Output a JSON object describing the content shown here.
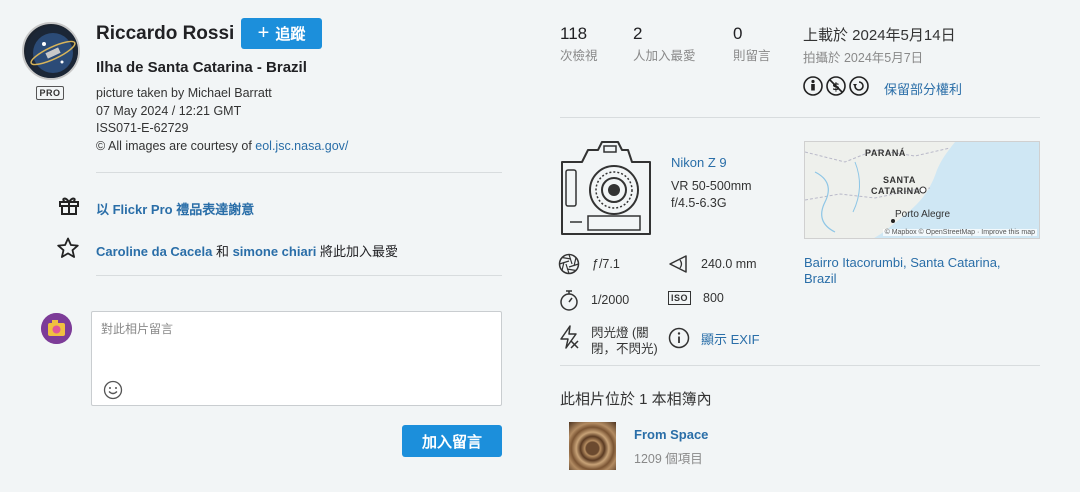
{
  "owner": {
    "name": "Riccardo Rossi",
    "pro_badge": "PRO",
    "follow_label": "追蹤",
    "follow_plus": "+"
  },
  "photo": {
    "title": "Ilha de Santa Catarina - Brazil",
    "description_lines": [
      "picture taken by Michael Barratt",
      "07 May 2024 / 12:21 GMT",
      "ISS071-E-62729"
    ],
    "courtesy_prefix": "© All images are courtesy of ",
    "courtesy_link": "eol.jsc.nasa.gov/"
  },
  "actions": {
    "gift_label": "以 Flickr Pro 禮品表達謝意",
    "fav_user1": "Caroline da Cacela",
    "fav_and": " 和 ",
    "fav_user2": "simone chiari",
    "fav_suffix": " 將此加入最愛"
  },
  "comment": {
    "placeholder": "對此相片留言",
    "submit_label": "加入留言"
  },
  "stats": {
    "views_num": "118",
    "views_label": "次檢視",
    "faves_num": "2",
    "faves_label": "人加入最愛",
    "comments_num": "0",
    "comments_label": "則留言"
  },
  "dates": {
    "uploaded": "上載於 2024年5月14日",
    "taken": "拍攝於 2024年5月7日"
  },
  "license": {
    "label": "保留部分權利",
    "icons": [
      "cc-by-icon",
      "noncommercial-icon",
      "share-alike-icon"
    ]
  },
  "camera": {
    "model": "Nikon Z 9",
    "lens_line1": "VR 50-500mm",
    "lens_line2": "f/4.5-6.3G"
  },
  "exif": {
    "aperture": "ƒ/7.1",
    "focal_length": "240.0 mm",
    "shutter": "1/2000",
    "iso_label": "ISO",
    "iso": "800",
    "flash_line1": "閃光燈 (關",
    "flash_line2": "閉，不閃光)",
    "show_exif": "顯示 EXIF"
  },
  "map": {
    "label_parana": "PARANÁ",
    "label_santa": "SANTA",
    "label_catarina": "CATARINA",
    "label_porto": "Porto Alegre",
    "attribution": "© Mapbox © OpenStreetMap · Improve this map"
  },
  "location": {
    "text": "Bairro Itacorumbi, Santa Catarina, Brazil"
  },
  "album": {
    "heading": "此相片位於 1 本相簿內",
    "title": "From Space",
    "count": "1209 個項目"
  },
  "colors": {
    "accent": "#1c8fdb",
    "link": "#2a6ea8",
    "background": "#f2f5f6"
  }
}
